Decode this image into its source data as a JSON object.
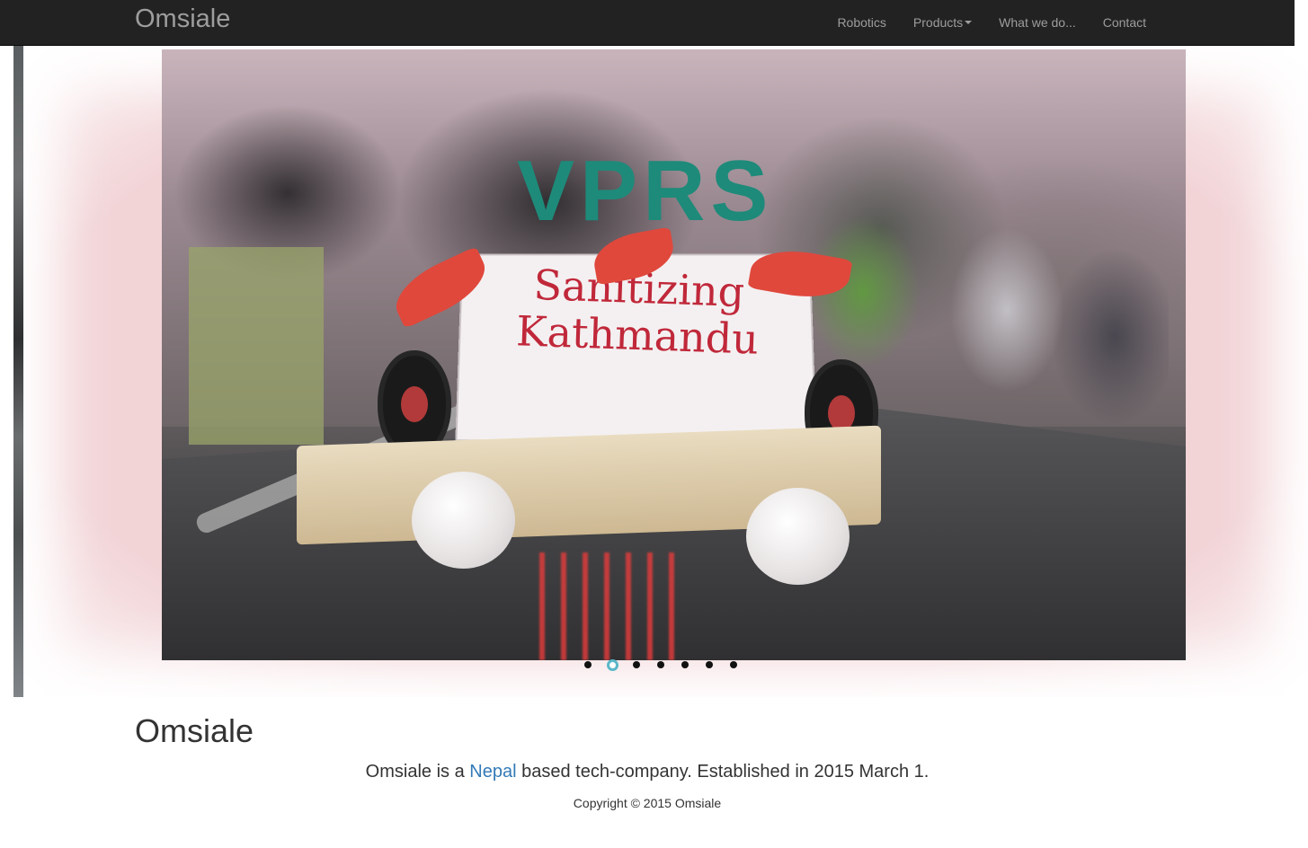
{
  "navbar": {
    "brand": "Omsiale",
    "items": [
      {
        "label": "Robotics"
      },
      {
        "label": "Products",
        "has_dropdown": true
      },
      {
        "label": "What we do..."
      },
      {
        "label": "Contact"
      }
    ],
    "background": "#222222",
    "link_color": "#9d9d9d"
  },
  "carousel": {
    "slide_texts": {
      "team_banner": "VPRS",
      "sign": "Sanitizing Kathmandu"
    },
    "indicator_count": 7,
    "active_index": 1,
    "backdrop_color": "#f2d4d7",
    "active_indicator_color": "#5ab8c9"
  },
  "main": {
    "heading": "Omsiale",
    "lead_before": "Omsiale is a",
    "lead_link": "Nepal",
    "lead_after": "based tech-company. Established in 2015 March 1.",
    "link_color": "#337ab7"
  },
  "footer": {
    "copyright": "Copyright © 2015 Omsiale"
  }
}
